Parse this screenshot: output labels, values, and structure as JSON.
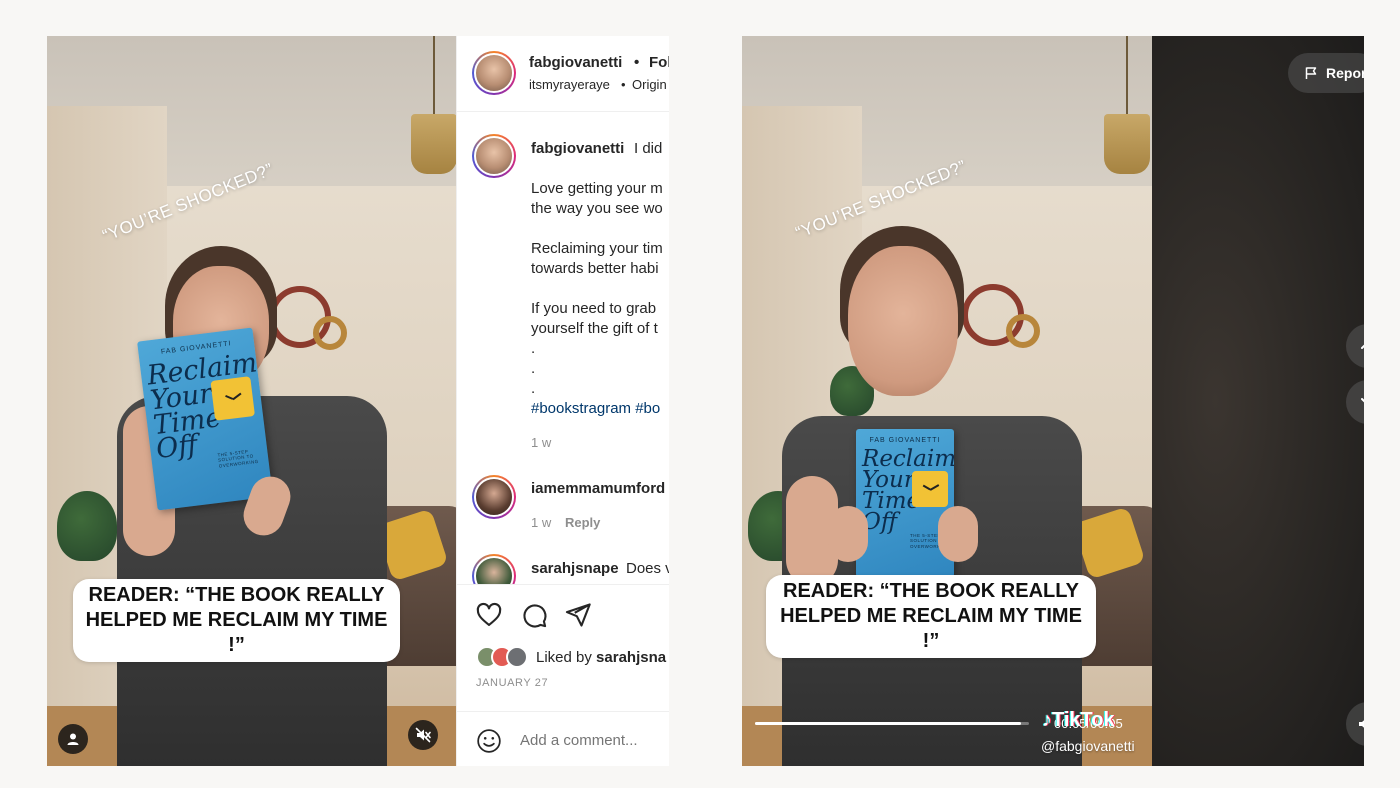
{
  "instagram": {
    "video": {
      "overlay_quote": "“YOU’RE SHOCKED?”",
      "caption_line1": "READER: “THE BOOK REALLY",
      "caption_line2": "HELPED ME RECLAIM MY TIME !”",
      "user_icon": "person-icon",
      "mute_icon": "muted-speaker-icon"
    },
    "book": {
      "author": "FAB GIOVANETTI",
      "title_line1": "Reclaim",
      "title_line2": "Your",
      "title_line3": "Time",
      "title_line4": "Off",
      "subtitle": "THE 5-STEP SOLUTION TO OVERWORKING"
    },
    "header": {
      "username": "fabgiovanetti",
      "separator": "•",
      "follow_label": "Fol",
      "audio_user": "itsmyrayeraye",
      "audio_label": "Origin"
    },
    "post": {
      "username": "fabgiovanetti",
      "caption_start": "I did",
      "lines": [
        "Love getting your m",
        "the way you see wo",
        "Reclaiming your tim",
        "towards better habi",
        "If you need to grab",
        "yourself the gift of t",
        ".",
        ".",
        "."
      ],
      "hashtags": "#bookstragram #bo",
      "time_ago": "1 w"
    },
    "comments": [
      {
        "username": "iamemmamumford",
        "text": "",
        "time_ago": "1 w",
        "reply_label": "Reply"
      },
      {
        "username": "sarahjsnape",
        "text": "Does v"
      }
    ],
    "actions": {
      "like_icon": "heart-icon",
      "comment_icon": "comment-bubble-icon",
      "share_icon": "paper-plane-icon",
      "liked_by_prefix": "Liked by",
      "liked_by_user": "sarahjsna",
      "date": "JANUARY 27"
    },
    "comment_box": {
      "emoji_icon": "smiley-icon",
      "placeholder": "Add a comment..."
    }
  },
  "tiktok": {
    "video": {
      "overlay_quote": "“YOU’RE SHOCKED?”",
      "caption_line1": "READER: “THE BOOK REALLY",
      "caption_line2": "HELPED ME RECLAIM MY TIME !”",
      "logo_text": "TikTok",
      "handle": "@fabgiovanetti",
      "time": "00:05/00:05",
      "progress": 0.97
    },
    "book": {
      "author": "FAB GIOVANETTI",
      "title_line1": "Reclaim",
      "title_line2": "Your",
      "title_line3": "Time",
      "title_line4": "Off",
      "subtitle": "THE 5-STEP SOLUTION TO OVERWORKING"
    },
    "side": {
      "report_label": "Repor",
      "report_icon": "flag-icon",
      "up_icon": "chevron-up-icon",
      "down_icon": "chevron-down-icon",
      "volume_icon": "speaker-icon"
    }
  }
}
